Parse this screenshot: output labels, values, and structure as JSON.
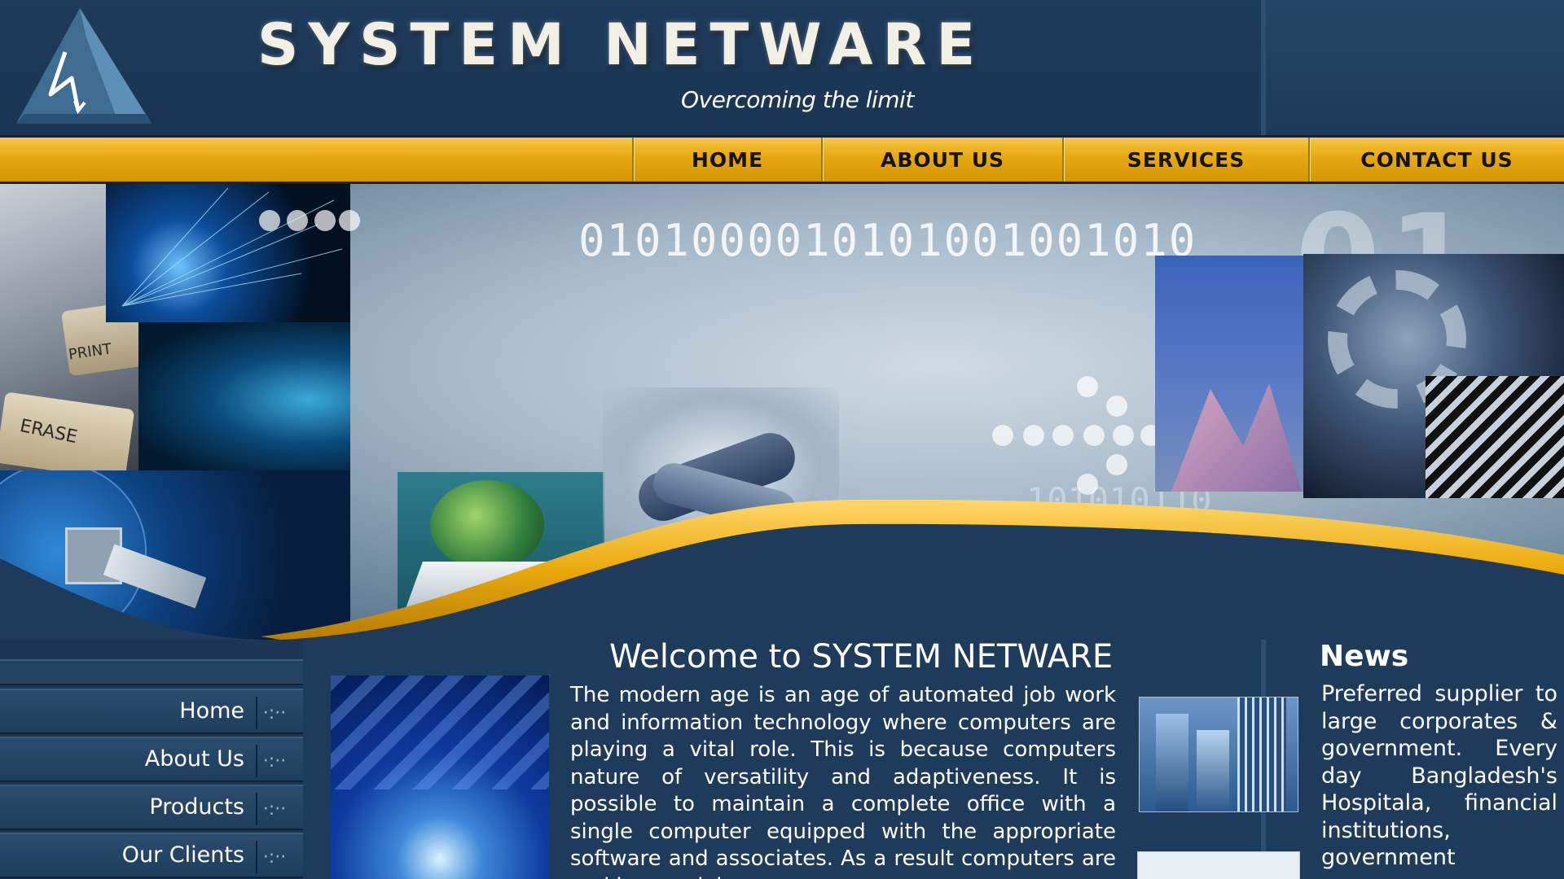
{
  "brand": {
    "name": "SYSTEM  NETWARE",
    "slogan": "Overcoming the limit"
  },
  "nav": {
    "items": [
      "HOME",
      "ABOUT US",
      "SERVICES",
      "CONTACT US"
    ]
  },
  "banner": {
    "binary_row": "0101000010101001001010",
    "binary_big": "01",
    "binary_low": "101010110",
    "keyboard_keys": [
      "PRINT",
      "ERASE"
    ]
  },
  "sidebar": {
    "items": [
      "Home",
      "About Us",
      "Products",
      "Our Clients"
    ],
    "arrow_glyph": "·:··"
  },
  "welcome": {
    "title": "Welcome to SYSTEM NETWARE",
    "text": "The modern age is an age of automated job work and information technology where computers are playing a vital role. This is because computers nature of versatility and adaptiveness. It is possible to maintain a complete office with a single computer equipped with the appropriate software and associates. As a result computers are making our job"
  },
  "news": {
    "title": "News",
    "text": "Preferred supplier to large corporates & government. Every day Bangladesh's Hospitala, financial institutions, government"
  },
  "colors": {
    "navy": "#1d3a5a",
    "gold": "#e7a80e",
    "text": "#ffffff"
  }
}
